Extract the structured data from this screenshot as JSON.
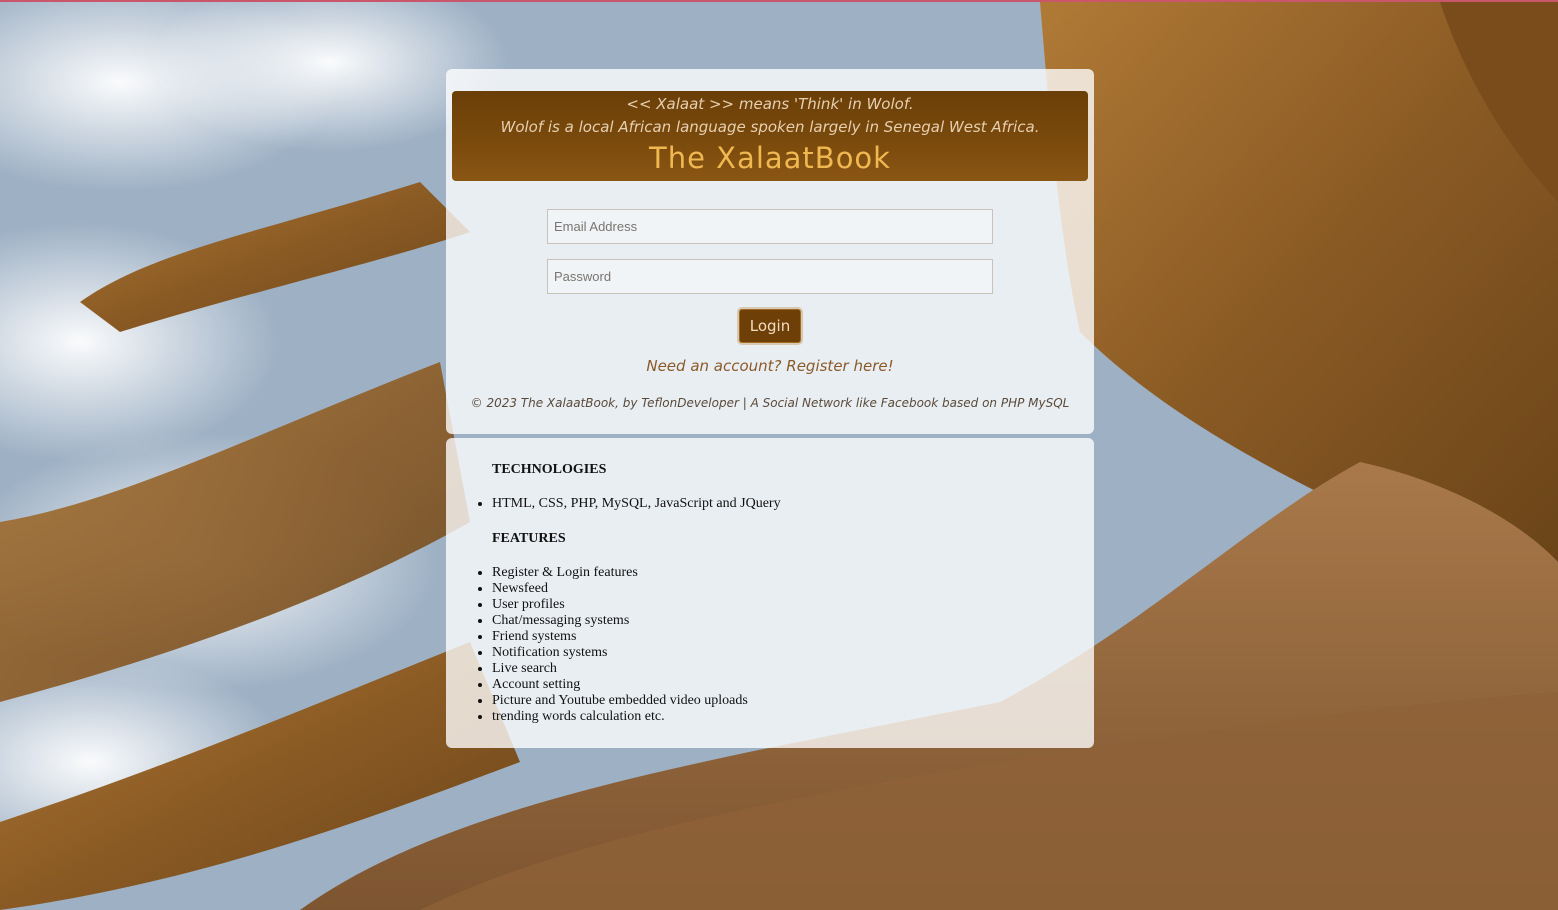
{
  "banner": {
    "line1": "<< Xalaat >> means 'Think' in Wolof.",
    "line2": "Wolof is a local African language spoken largely in Senegal West Africa.",
    "title": "The XalaatBook"
  },
  "form": {
    "email_placeholder": "Email Address",
    "password_placeholder": "Password",
    "login_label": "Login",
    "register_link": "Need an account? Register here!"
  },
  "footer": {
    "text": "© 2023 The XalaatBook, by TeflonDeveloper | A Social Network like Facebook based on PHP MySQL"
  },
  "info": {
    "technologies_heading": "TECHNOLOGIES",
    "technologies": [
      "HTML, CSS, PHP, MySQL, JavaScript and JQuery"
    ],
    "features_heading": "FEATURES",
    "features": [
      "Register & Login features",
      "Newsfeed",
      "User profiles",
      "Chat/messaging systems",
      "Friend systems",
      "Notification systems",
      "Live search",
      "Account setting",
      "Picture and Youtube embedded video uploads",
      "trending words calculation etc."
    ]
  },
  "colors": {
    "banner": "#7a4a0c",
    "title": "#f0b850",
    "button": "#6e3f06"
  }
}
